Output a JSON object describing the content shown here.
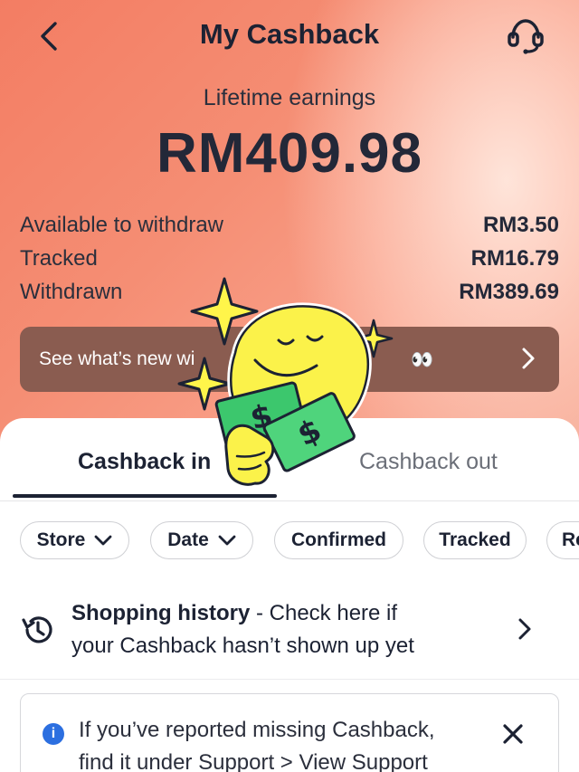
{
  "header": {
    "title": "My Cashback",
    "back_icon": "chevron-left-icon",
    "support_icon": "headset-icon"
  },
  "summary": {
    "lifetime_label": "Lifetime earnings",
    "lifetime_amount": "RM409.98",
    "stats": [
      {
        "label": "Available to withdraw",
        "value": "RM3.50"
      },
      {
        "label": "Tracked",
        "value": "RM16.79"
      },
      {
        "label": "Withdrawn",
        "value": "RM389.69"
      }
    ]
  },
  "promo": {
    "text": "See what’s new wi",
    "trailing": "👀"
  },
  "tabs": [
    {
      "label": "Cashback in",
      "active": true
    },
    {
      "label": "Cashback out",
      "active": false
    }
  ],
  "filters": [
    {
      "label": "Store",
      "dropdown": true
    },
    {
      "label": "Date",
      "dropdown": true
    },
    {
      "label": "Confirmed",
      "dropdown": false
    },
    {
      "label": "Tracked",
      "dropdown": false
    },
    {
      "label": "Re",
      "dropdown": false
    }
  ],
  "history": {
    "title": "Shopping history",
    "line1": " - Check here if",
    "line2": "your Cashback hasn’t shown up yet"
  },
  "notice": {
    "line1": "If you’ve reported missing Cashback,",
    "line2": "find it under Support > View Support"
  },
  "colors": {
    "hero_start": "#f37d63",
    "banner": "#8a5c50",
    "info": "#2c6fe0",
    "text_dark": "#1c2233"
  }
}
